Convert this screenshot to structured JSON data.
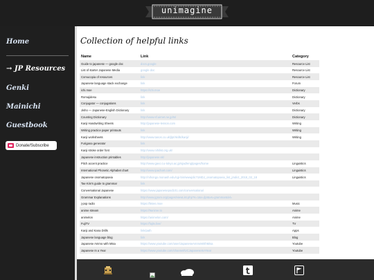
{
  "header": {
    "logo_text": "unimagine"
  },
  "sidebar": {
    "items": [
      {
        "label": "Home"
      },
      {
        "label": "→ JP Resources"
      },
      {
        "label": "Genki"
      },
      {
        "label": "Mainichi"
      },
      {
        "label": "Guestbook"
      }
    ],
    "donate_label": "Donate/Subscribe"
  },
  "main": {
    "title": "Collection of helpful links",
    "columns": [
      "Name",
      "Link",
      "Category"
    ],
    "rows": [
      {
        "name": "Guide to japanese — google doc",
        "link": "docs.google",
        "category": "Resource List"
      },
      {
        "name": "List of starter Japanese Media",
        "link": "google doc",
        "category": "Resource List"
      },
      {
        "name": "Comucopia of resources",
        "link": "link",
        "category": "Resource List"
      },
      {
        "name": "Japanese language stack exchange",
        "link": "link",
        "category": "Forum"
      },
      {
        "name": "ichi.moe",
        "link": "https://ichi.moe",
        "category": "Dictionary"
      },
      {
        "name": "Romajidesu",
        "link": "link",
        "category": "Dictionary"
      },
      {
        "name": "Conjugator — conjugations",
        "link": "link",
        "category": "Verbs"
      },
      {
        "name": "Jisho — Japanese-English Dictionary",
        "link": "link",
        "category": "Dictionary"
      },
      {
        "name": "Counting Dictionary",
        "link": "http://www.sf.airnet.ne.jp/ts/",
        "category": "Dictionary"
      },
      {
        "name": "Kanji Handwriting Sheets",
        "link": "http://japanese-lesson.com",
        "category": "Writing"
      },
      {
        "name": "Writing practice paper printouts",
        "link": "link",
        "category": "Writing"
      },
      {
        "name": "Kanji worksheets",
        "link": "http://www.tanos.co.uk/jlpt/skills/kanji/",
        "category": "Writing"
      },
      {
        "name": "Furigana generator",
        "link": "link",
        "category": ""
      },
      {
        "name": "Kanji stroke order font",
        "link": "http://www.nihilist.org.uk/",
        "category": ""
      },
      {
        "name": "Japanese instruction printables",
        "link": "http://japanese.sk/",
        "category": ""
      },
      {
        "name": "Pitch accent practice",
        "link": "http://www.gavo.t.u-tokyo.ac.jp/ojad/eng/pages/home",
        "category": "Linguistics"
      },
      {
        "name": "International Phonetic Alphabet chart",
        "link": "http://www.ipachart.com/",
        "category": "Linguistics"
      },
      {
        "name": "Japanese onomatopoeia",
        "link": "http://nihongo.monash.edu/cgi-bin/wwwjdic?1MDJ_onomatopoeia_list_jmdict_2018_02_18",
        "category": "Linguistics"
      },
      {
        "name": "Tae Kim's guide to grammar",
        "link": "link",
        "category": ""
      },
      {
        "name": "Conversational Japanese",
        "link": "https://www.japanesepod101.com/conversational",
        "category": ""
      },
      {
        "name": "Grammar Explanations",
        "link": "http://www.jgram.org/pages/viewList.php?s=1&v=jlpt&vs=grammar&lvl=",
        "category": ""
      },
      {
        "name": "j-pop radio",
        "link": "https://listen.moe",
        "category": "Music"
      },
      {
        "name": "anime stream",
        "link": "https://9anime.to",
        "category": "Anime"
      },
      {
        "name": "animelon",
        "link": "https://animelon.com/",
        "category": "Anime"
      },
      {
        "name": "FujiTV",
        "link": "https://fujitv.live/",
        "category": "TV"
      },
      {
        "name": "Kanji and Kana Drills",
        "link": "link/path",
        "category": "Apps"
      },
      {
        "name": "Japanese language blog",
        "link": "link",
        "category": "Blog"
      },
      {
        "name": "Japanese Ammo with Misa",
        "link": "https://www.youtube.com/user/JapaneseAmmoWithMisa",
        "category": "Youtube"
      },
      {
        "name": "Japanese In a Year",
        "link": "https://www.youtube.com/channel/UCJapaneseInAYear",
        "category": "Youtube"
      }
    ]
  },
  "footer": {
    "icons": [
      "pixel-art-icon",
      "broken-image-icon",
      "soundcloud-icon",
      "tumblr-icon",
      "flag-icon"
    ]
  }
}
